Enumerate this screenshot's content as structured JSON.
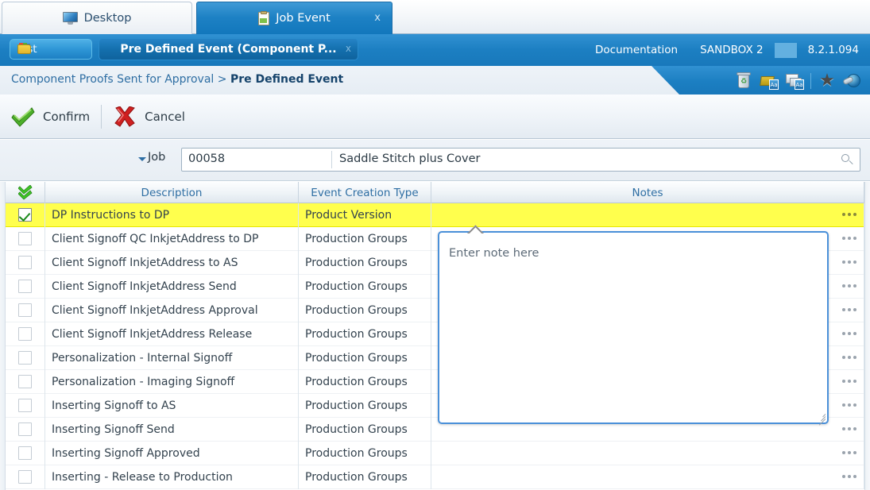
{
  "tabs": [
    {
      "label": "Desktop",
      "icon": "monitor-icon",
      "active": false,
      "closable": false
    },
    {
      "label": "Job Event",
      "icon": "clipboard-icon",
      "active": true,
      "closable": true,
      "close_label": "x"
    }
  ],
  "bluebar": {
    "list_button": {
      "label": "List",
      "icon": "folder-icon"
    },
    "predefined_button": {
      "label": "Pre Defined Event (Component P...",
      "close_label": "x"
    },
    "links": [
      "Documentation",
      "SANDBOX 2",
      "8.2.1.094"
    ]
  },
  "breadcrumb": {
    "parent": "Component Proofs Sent for Approval",
    "separator": ">",
    "current": "Pre Defined Event",
    "icons": [
      "recycle-bin-icon",
      "folder-aa-icon",
      "screen-aa-icon",
      "star-icon",
      "globe-key-icon"
    ]
  },
  "toolbar": {
    "confirm_label": "Confirm",
    "cancel_label": "Cancel"
  },
  "job_field": {
    "label": "Job",
    "number": "00058",
    "description": "Saddle Stitch plus Cover",
    "search_icon": "search-icon"
  },
  "grid": {
    "columns": [
      "",
      "Description",
      "Event Creation Type",
      "Notes"
    ],
    "select_all_icon": "double-check-icon",
    "rows": [
      {
        "checked": true,
        "selected": true,
        "description": "DP Instructions to DP",
        "type": "Product Version"
      },
      {
        "checked": false,
        "selected": false,
        "description": "Client Signoff QC InkjetAddress to DP",
        "type": "Production Groups"
      },
      {
        "checked": false,
        "selected": false,
        "description": "Client Signoff InkjetAddress to AS",
        "type": "Production Groups"
      },
      {
        "checked": false,
        "selected": false,
        "description": "Client Signoff InkjetAddress Send",
        "type": "Production Groups"
      },
      {
        "checked": false,
        "selected": false,
        "description": "Client Signoff InkjetAddress Approval",
        "type": "Production Groups"
      },
      {
        "checked": false,
        "selected": false,
        "description": "Client Signoff InkjetAddress Release",
        "type": "Production Groups"
      },
      {
        "checked": false,
        "selected": false,
        "description": "Personalization - Internal Signoff",
        "type": "Production Groups"
      },
      {
        "checked": false,
        "selected": false,
        "description": "Personalization - Imaging Signoff",
        "type": "Production Groups"
      },
      {
        "checked": false,
        "selected": false,
        "description": "Inserting Signoff to AS",
        "type": "Production Groups"
      },
      {
        "checked": false,
        "selected": false,
        "description": "Inserting Signoff Send",
        "type": "Production Groups"
      },
      {
        "checked": false,
        "selected": false,
        "description": "Inserting Signoff Approved",
        "type": "Production Groups"
      },
      {
        "checked": false,
        "selected": false,
        "description": "Inserting - Release to Production",
        "type": "Production Groups"
      }
    ]
  },
  "note_popup": {
    "placeholder": "Enter note here",
    "value": ""
  },
  "colors": {
    "accent_blue": "#1878bb",
    "tab_active": "#1d81c4",
    "selected_row": "#ffff4d",
    "link_blue": "#2e6ea3",
    "popup_border": "#4a90d9"
  }
}
